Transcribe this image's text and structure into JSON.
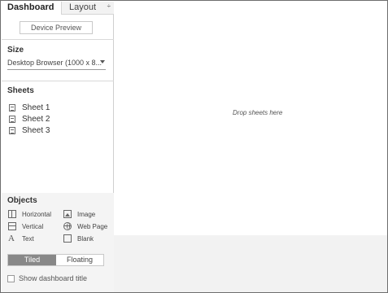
{
  "tabs": {
    "dashboard": "Dashboard",
    "layout": "Layout",
    "layout_arrow": "÷"
  },
  "device_preview": "Device Preview",
  "size": {
    "title": "Size",
    "value": "Desktop Browser (1000 x 8..."
  },
  "sheets": {
    "title": "Sheets",
    "items": [
      "Sheet 1",
      "Sheet 2",
      "Sheet 3"
    ]
  },
  "objects": {
    "title": "Objects",
    "items": [
      {
        "label": "Horizontal",
        "icon": "horizontal-container-icon"
      },
      {
        "label": "Image",
        "icon": "image-icon"
      },
      {
        "label": "Vertical",
        "icon": "vertical-container-icon"
      },
      {
        "label": "Web Page",
        "icon": "web-page-icon"
      },
      {
        "label": "Text",
        "icon": "text-icon"
      },
      {
        "label": "Blank",
        "icon": "blank-icon"
      }
    ]
  },
  "layout_mode": {
    "tiled": "Tiled",
    "floating": "Floating",
    "selected": "Tiled"
  },
  "show_title": {
    "label": "Show dashboard title",
    "checked": false
  },
  "canvas": {
    "drop_hint": "Drop sheets here"
  },
  "colors": {
    "tiled_active_bg": "#888888",
    "canvas_bg": "#ffffff",
    "footer_bg": "#f2f2f2"
  }
}
